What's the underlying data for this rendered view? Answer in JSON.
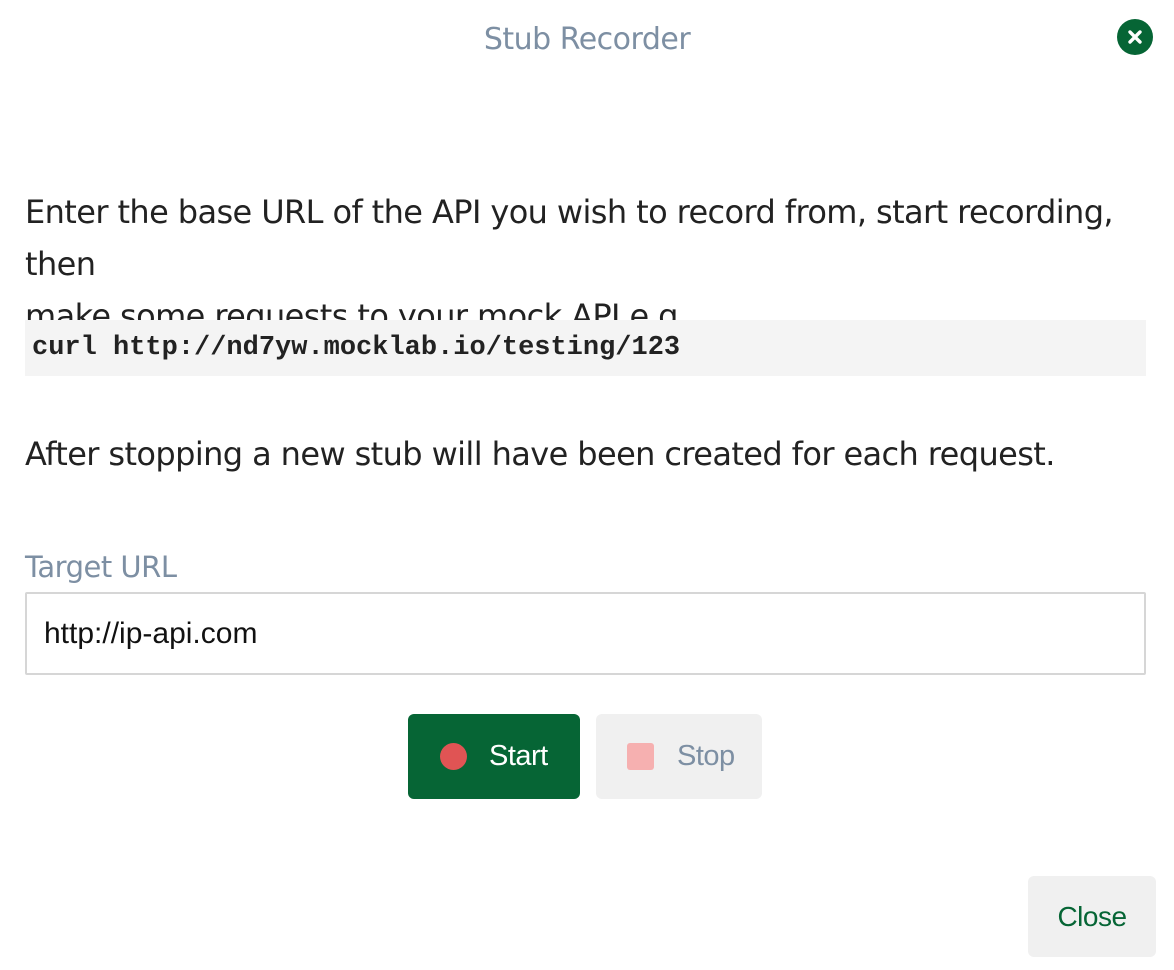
{
  "dialog": {
    "title": "Stub Recorder",
    "close_icon": "close-circle-icon"
  },
  "content": {
    "intro_line1": "Enter the base URL of the API you wish to record from, start recording, then",
    "intro_line2": "make some requests to your mock API e.g.",
    "example_command": "curl http://nd7yw.mocklab.io/testing/123",
    "after_text": "After stopping a new stub will have been created for each request."
  },
  "form": {
    "target_url_label": "Target URL",
    "target_url_value": "http://ip-api.com"
  },
  "buttons": {
    "start_label": "Start",
    "start_icon": "record-dot-icon",
    "stop_label": "Stop",
    "stop_icon": "stop-square-icon",
    "close_label": "Close"
  },
  "colors": {
    "primary_green": "#066535",
    "record_red": "#e05454",
    "stop_pink": "#f6b0b0",
    "label_gray": "#7d8fa3"
  }
}
